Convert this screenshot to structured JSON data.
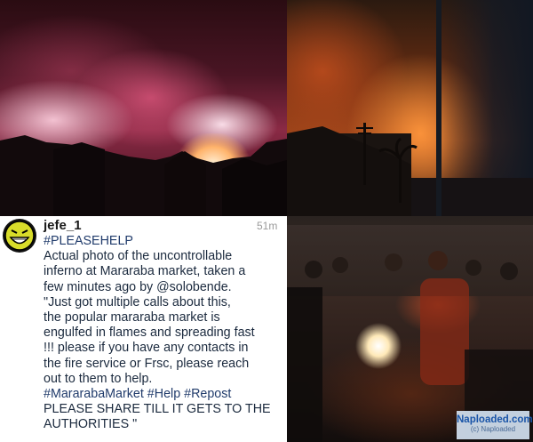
{
  "post": {
    "username": "jefe_1",
    "time_ago": "51m",
    "caption_lines": [
      "#PLEASEHELP",
      "Actual photo of the uncontrollable",
      "inferno at Mararaba market, taken a",
      "few minutes ago by @solobende.",
      "\"Just got multiple calls about this,",
      "the popular mararaba market is",
      "engulfed in flames and spreading fast",
      "!!! please if you have any contacts in",
      "the fire service or Frsc, please reach",
      "out to them to help.",
      "#MararabaMarket #Help #Repost",
      "PLEASE SHARE TILL IT GETS TO THE",
      "AUTHORITIES \""
    ]
  },
  "avatar": {
    "icon": "grinning-face-icon",
    "color": "#d8dc2a"
  },
  "watermark": {
    "main": "Naploaded.com",
    "sub": "(c) Naploaded"
  },
  "colors": {
    "caption_text": "#1b2a3e",
    "hashtag": "#203b6b",
    "watermark": "#1a55a8"
  }
}
